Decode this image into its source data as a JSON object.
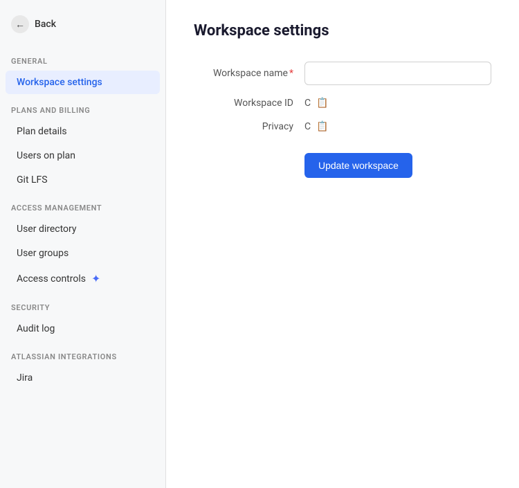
{
  "sidebar": {
    "back_label": "Back",
    "sections": [
      {
        "label": "General",
        "items": [
          {
            "id": "workspace-settings",
            "label": "Workspace settings",
            "active": true,
            "icon": null
          }
        ]
      },
      {
        "label": "Plans and billing",
        "items": [
          {
            "id": "plan-details",
            "label": "Plan details",
            "active": false,
            "icon": null
          },
          {
            "id": "users-on-plan",
            "label": "Users on plan",
            "active": false,
            "icon": null
          },
          {
            "id": "git-lfs",
            "label": "Git LFS",
            "active": false,
            "icon": null
          }
        ]
      },
      {
        "label": "Access management",
        "items": [
          {
            "id": "user-directory",
            "label": "User directory",
            "active": false,
            "icon": null
          },
          {
            "id": "user-groups",
            "label": "User groups",
            "active": false,
            "icon": null
          },
          {
            "id": "access-controls",
            "label": "Access controls",
            "active": false,
            "icon": "sparkle"
          }
        ]
      },
      {
        "label": "Security",
        "items": [
          {
            "id": "audit-log",
            "label": "Audit log",
            "active": false,
            "icon": null
          }
        ]
      },
      {
        "label": "Atlassian integrations",
        "items": [
          {
            "id": "jira",
            "label": "Jira",
            "active": false,
            "icon": null
          }
        ]
      }
    ]
  },
  "main": {
    "title": "Workspace settings",
    "form": {
      "workspace_name_label": "Workspace name",
      "workspace_id_label": "Workspace ID",
      "privacy_label": "Privacy",
      "workspace_name_value": "",
      "workspace_id_value": "C",
      "privacy_value": "C",
      "update_button_label": "Update workspace"
    }
  }
}
